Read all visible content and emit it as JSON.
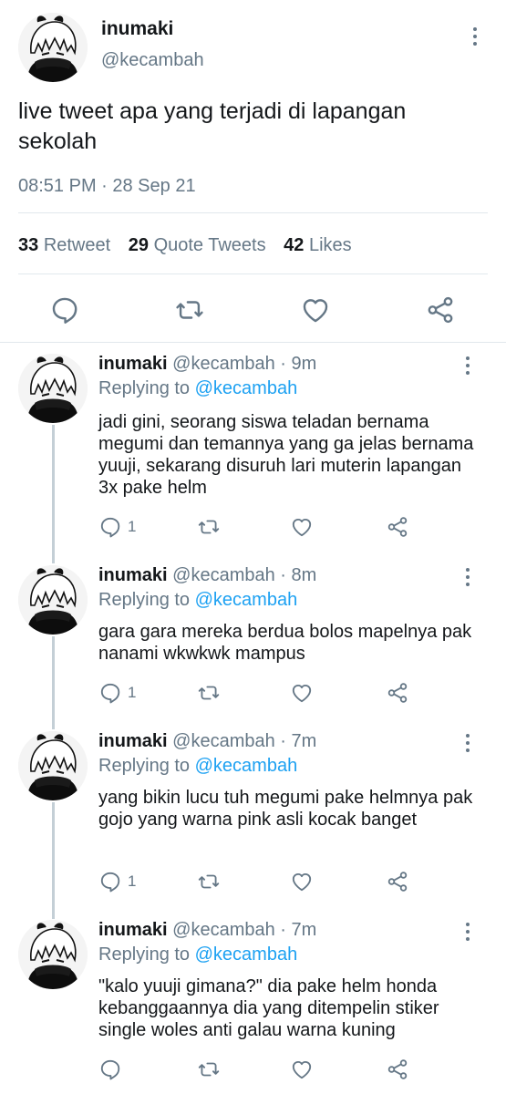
{
  "main_tweet": {
    "name": "inumaki",
    "handle": "@kecambah",
    "text": "live tweet apa yang terjadi di lapangan sekolah",
    "timestamp": "08:51 PM · 28 Sep 21",
    "retweets": "33",
    "retweets_label": "Retweet",
    "quotes": "29",
    "quotes_label": "Quote Tweets",
    "likes": "42",
    "likes_label": "Likes"
  },
  "replies": [
    {
      "name": "inumaki",
      "handle": "@kecambah",
      "time": "· 9m",
      "replying_prefix": "Replying to",
      "replying_to": "@kecambah",
      "text": "jadi gini, seorang siswa teladan bernama megumi dan temannya yang ga jelas bernama yuuji, sekarang disuruh lari muterin lapangan 3x pake helm",
      "reply_count": "1"
    },
    {
      "name": "inumaki",
      "handle": "@kecambah",
      "time": "· 8m",
      "replying_prefix": "Replying to",
      "replying_to": "@kecambah",
      "text": "gara gara mereka berdua bolos mapelnya pak nanami wkwkwk mampus",
      "reply_count": "1"
    },
    {
      "name": "inumaki",
      "handle": "@kecambah",
      "time": "· 7m",
      "replying_prefix": "Replying to",
      "replying_to": "@kecambah",
      "text": "yang bikin lucu tuh megumi pake helmnya pak gojo yang warna pink asli kocak banget",
      "reply_count": "1"
    },
    {
      "name": "inumaki",
      "handle": "@kecambah",
      "time": "· 7m",
      "replying_prefix": "Replying to",
      "replying_to": "@kecambah",
      "text": "\"kalo yuuji gimana?\" dia pake helm honda kebanggaannya dia yang ditempelin stiker single woles anti galau warna kuning",
      "reply_count": ""
    }
  ],
  "colors": {
    "text": "#14171a",
    "secondary": "#657786",
    "link": "#1da1f2",
    "divider": "#e1e8ed"
  }
}
